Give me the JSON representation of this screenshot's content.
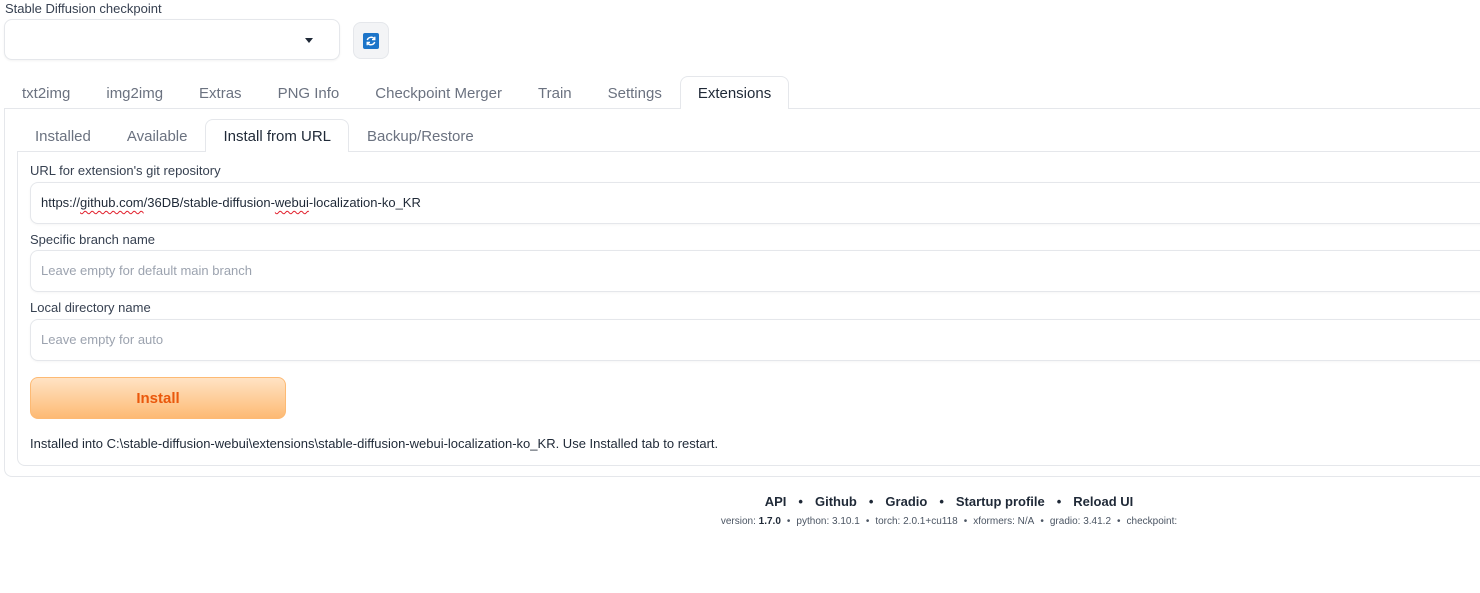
{
  "checkpoint": {
    "label": "Stable Diffusion checkpoint",
    "selected": "",
    "refresh_icon": "refresh-icon"
  },
  "top_tabs": [
    "txt2img",
    "img2img",
    "Extras",
    "PNG Info",
    "Checkpoint Merger",
    "Train",
    "Settings",
    "Extensions"
  ],
  "top_tabs_active": "Extensions",
  "sub_tabs": [
    "Installed",
    "Available",
    "Install from URL",
    "Backup/Restore"
  ],
  "sub_tabs_active": "Install from URL",
  "form": {
    "url_label": "URL for extension's git repository",
    "url_value": "https://github.com/36DB/stable-diffusion-webui-localization-ko_KR",
    "url_parts": {
      "p1": "https://",
      "p2": "github.com",
      "p3": "/36DB/stable-diffusion-",
      "p4": "webui",
      "p5": "-localization-ko_KR"
    },
    "branch_label": "Specific branch name",
    "branch_placeholder": "Leave empty for default main branch",
    "dir_label": "Local directory name",
    "dir_placeholder": "Leave empty for auto",
    "install_label": "Install",
    "status": "Installed into C:\\stable-diffusion-webui\\extensions\\stable-diffusion-webui-localization-ko_KR. Use Installed tab to restart."
  },
  "footer": {
    "links": [
      "API",
      "Github",
      "Gradio",
      "Startup profile",
      "Reload UI"
    ],
    "separator": "•",
    "versions": {
      "version_label": "version:",
      "version_value": "1.7.0",
      "python": "python: 3.10.1",
      "torch": "torch: 2.0.1+cu118",
      "xformers": "xformers: N/A",
      "gradio": "gradio: 3.41.2",
      "checkpoint": "checkpoint:"
    }
  },
  "colors": {
    "accent_orange": "#ea580c",
    "install_bg_top": "#ffe3c4",
    "install_bg_bottom": "#fdba74",
    "refresh_blue": "#1d75c9"
  }
}
